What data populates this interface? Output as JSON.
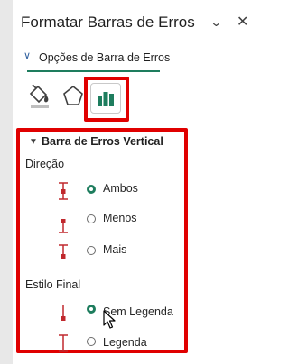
{
  "pane": {
    "title": "Formatar Barras de Erros",
    "chevron_icon": "chevron-down-icon",
    "close_icon": "close-icon"
  },
  "tab": {
    "label": "Opções de Barra de Erros"
  },
  "toolbar": {
    "icons": [
      "fill-line-icon",
      "effects-pentagon-icon",
      "error-bar-options-icon"
    ]
  },
  "section": {
    "title": "Barra de Erros Vertical",
    "direction": {
      "label": "Direção",
      "options": [
        {
          "label": "Ambos",
          "checked": true
        },
        {
          "label": "Menos",
          "checked": false
        },
        {
          "label": "Mais",
          "checked": false
        }
      ]
    },
    "end_style": {
      "label": "Estilo Final",
      "options": [
        {
          "label": "Sem Legenda",
          "checked": true
        },
        {
          "label": "Legenda",
          "checked": false
        }
      ]
    }
  },
  "colors": {
    "accent": "#1e7d5e",
    "highlight": "#e00000",
    "icon_red": "#c0282d"
  }
}
